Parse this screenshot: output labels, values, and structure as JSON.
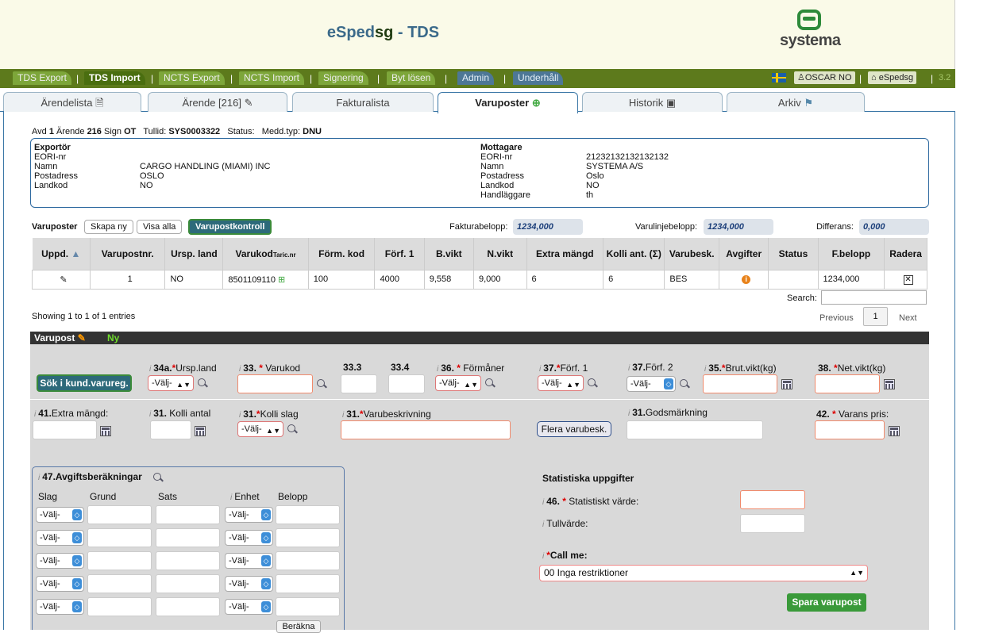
{
  "header": {
    "title_pre": "eSped",
    "title_sg": "sg",
    "title_post": " - TDS",
    "logo_text": "systema"
  },
  "topnav": {
    "items": [
      "TDS Export",
      "TDS Import",
      "NCTS Export",
      "NCTS Import",
      "Signering",
      "Byt lösen",
      "Admin",
      "Underhåll"
    ],
    "separator": "|",
    "user": "OSCAR NO",
    "app": "eSpedsg",
    "version": "3.2"
  },
  "tabs": [
    "Ärendelista",
    "Ärende [216]",
    "Fakturalista",
    "Varuposter",
    "Historik",
    "Arkiv"
  ],
  "summary": {
    "avd_label": "Avd",
    "avd": "1",
    "arende_label": "Ärende",
    "arende": "216",
    "sign_label": "Sign",
    "sign": "OT",
    "tullid_label": "Tullid:",
    "tullid": "SYS0003322",
    "status_label": "Status:",
    "meddtyp_label": "Medd.typ:",
    "meddtyp": "DNU"
  },
  "exportor": {
    "title": "Exportör",
    "rows": [
      {
        "k": "EORI-nr",
        "v": ""
      },
      {
        "k": "Namn",
        "v": "CARGO HANDLING (MIAMI) INC"
      },
      {
        "k": "Postadress",
        "v": "OSLO"
      },
      {
        "k": "Landkod",
        "v": "NO"
      }
    ]
  },
  "mottagare": {
    "title": "Mottagare",
    "rows": [
      {
        "k": "EORI-nr",
        "v": "21232132132132132"
      },
      {
        "k": "Namn",
        "v": "SYSTEMA A/S"
      },
      {
        "k": "Postadress",
        "v": "Oslo"
      },
      {
        "k": "Landkod",
        "v": "NO"
      },
      {
        "k": "Handläggare",
        "v": "th"
      }
    ]
  },
  "varuposter_bar": {
    "label": "Varuposter",
    "btn_skapa": "Skapa ny",
    "btn_visa": "Visa alla",
    "btn_kontroll": "Varupostkontroll",
    "fakturabelopp_label": "Fakturabelopp:",
    "fakturabelopp": "1234,000",
    "varulinje_label": "Varulinjebelopp:",
    "varulinje": "1234,000",
    "differans_label": "Differans:",
    "differans": "0,000"
  },
  "grid": {
    "headers": [
      "Uppd.",
      "Varupostnr.",
      "Ursp. land",
      "Varukod",
      "Förm. kod",
      "Förf. 1",
      "B.vikt",
      "N.vikt",
      "Extra mängd",
      "Kolli ant. (Σ)",
      "Varubesk.",
      "Avgifter",
      "Status",
      "F.belopp",
      "Radera"
    ],
    "varukod_suffix": "Taric.nr",
    "row": {
      "nr": "1",
      "ursp": "NO",
      "varukod": "8501109110",
      "form": "100",
      "forf": "4000",
      "bvikt": "9,558",
      "nvikt": "9,000",
      "extra": "6",
      "kolli": "6",
      "varubesk": "BES",
      "fbelopp": "1234,000"
    }
  },
  "search_label": "Search:",
  "showing": "Showing 1 to 1 of 1 entries",
  "pager": {
    "prev": "Previous",
    "page": "1",
    "next": "Next"
  },
  "form": {
    "title": "Varupost",
    "ny": "Ny",
    "sok_btn": "Sök i kund.varureg.",
    "select_default": "-Välj-",
    "l34a": "34a.",
    "l34a_t": "Ursp.land",
    "l33": "33.",
    "l33_t": "Varukod",
    "l333": "33.3",
    "l334": "33.4",
    "l36": "36.",
    "l36_t": "Förmåner",
    "l37": "37.",
    "l37_t": "Förf. 1",
    "l372": "37.",
    "l372_t": "Förf. 2",
    "l35": "35.",
    "l35_t": "Brut.vikt(kg)",
    "l38": "38.",
    "l38_t": "Net.vikt(kg)",
    "l41": "41.",
    "l41_t": "Extra mängd:",
    "l31a": "31.",
    "l31a_t": "Kolli antal",
    "l31b": "31.",
    "l31b_t": "Kolli slag",
    "l31c": "31.",
    "l31c_t": "Varubeskrivning",
    "flera": "Flera varubesk.",
    "l31d": "31.",
    "l31d_t": "Godsmärkning",
    "l42": "42.",
    "l42_t": "Varans pris:",
    "avg_title": "47.Avgiftsberäkningar",
    "avg_cols": [
      "Slag",
      "Grund",
      "Sats",
      "Enhet",
      "Belopp"
    ],
    "berakna": "Beräkna",
    "stat_title": "Statistiska uppgifter",
    "l46": "46.",
    "l46_t": "Statistiskt värde:",
    "tullvarde": "Tullvärde:",
    "callme": "Call me:",
    "callme_value": "00 Inga restriktioner",
    "spara": "Spara varupost"
  }
}
